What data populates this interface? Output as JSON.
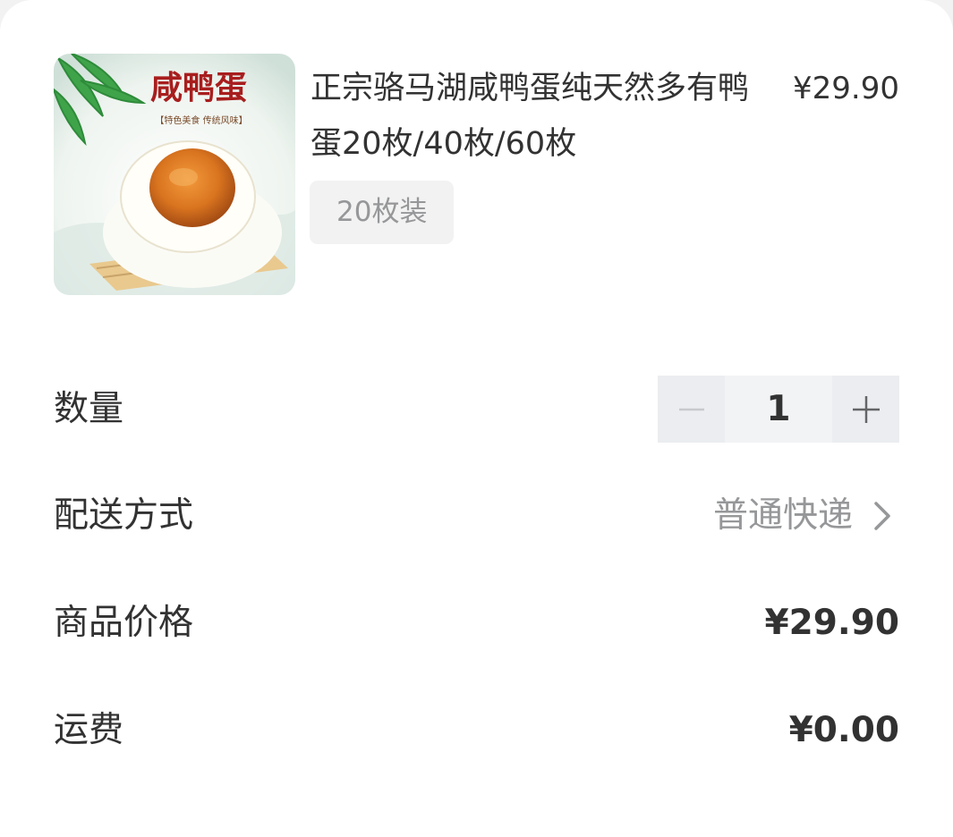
{
  "product": {
    "image_text": "咸鸭蛋",
    "image_subtext": "【特色美食 传统风味】",
    "title": "正宗骆马湖咸鸭蛋纯天然多有鸭蛋20枚/40枚/60枚",
    "price": "¥29.90",
    "spec": "20枚装"
  },
  "quantity": {
    "label": "数量",
    "value": "1",
    "decrease_icon": "minus-icon",
    "increase_icon": "plus-icon"
  },
  "delivery": {
    "label": "配送方式",
    "value": "普通快递",
    "icon": "chevron-right-icon"
  },
  "goods_price": {
    "label": "商品价格",
    "value": "¥29.90"
  },
  "shipping": {
    "label": "运费",
    "value": "¥0.00"
  },
  "colors": {
    "text_primary": "#323233",
    "text_muted": "#969799",
    "stepper_button": "#ebedf0",
    "stepper_input": "#f2f3f5",
    "egg_yolk": "#d9741f",
    "title_red": "#a81e1e"
  }
}
